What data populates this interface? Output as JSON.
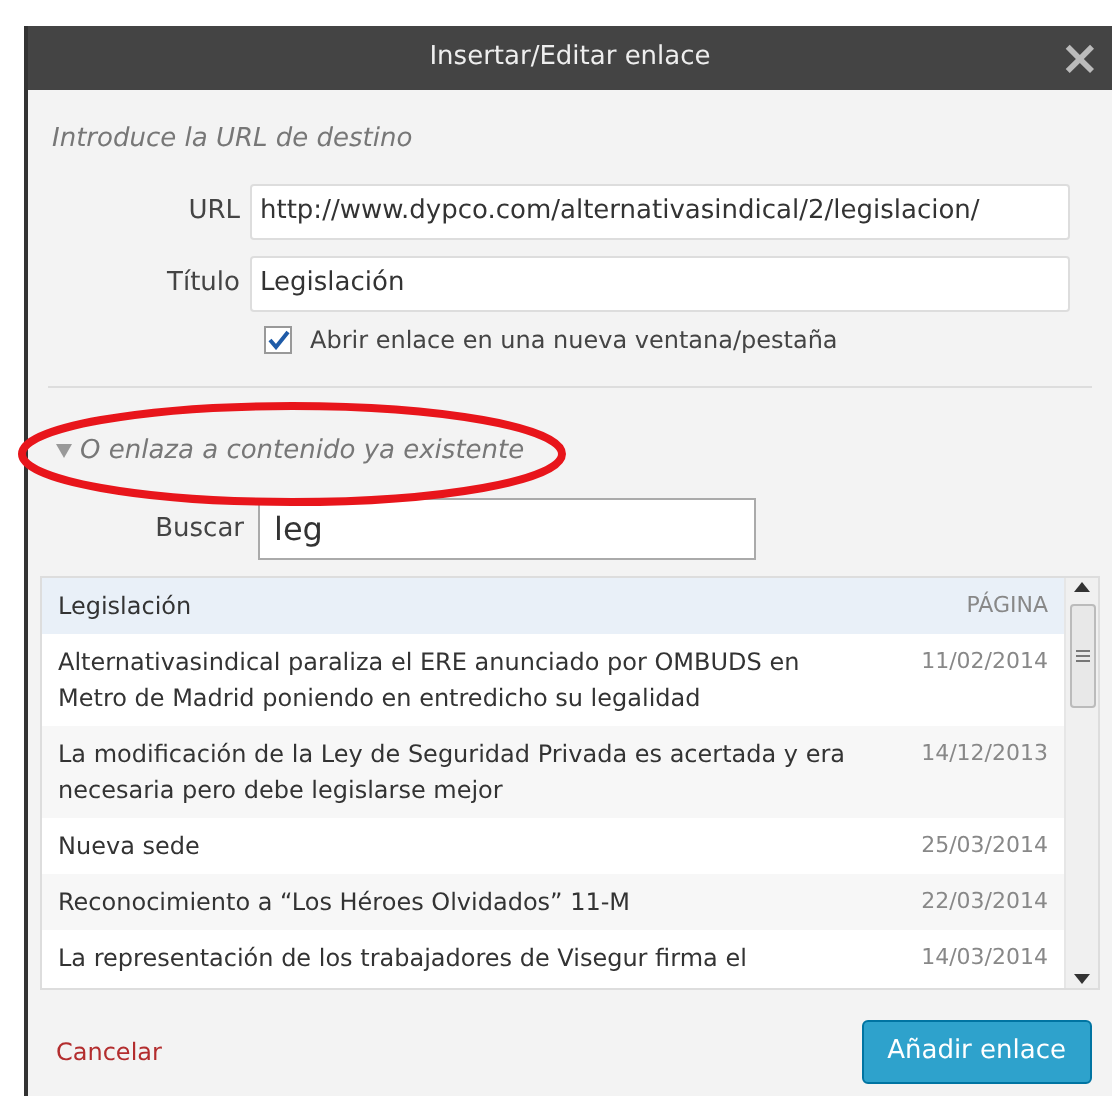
{
  "window": {
    "title": "Insertar/Editar enlace",
    "close": "×"
  },
  "url_section": {
    "heading": "Introduce la URL de destino",
    "url_label": "URL",
    "url_value": "http://www.dypco.com/alternativasindical/2/legislacion/",
    "title_label": "Título",
    "title_value": "Legislación",
    "new_tab": {
      "label": "Abrir enlace en una nueva ventana/pestaña",
      "checked": true
    }
  },
  "existing_section": {
    "toggle": "O enlaza a contenido ya existente",
    "expanded": true,
    "search_label": "Buscar",
    "search_value": "leg"
  },
  "results": [
    {
      "title": "Legislación",
      "info": "PÁGINA",
      "selected": true
    },
    {
      "title": "Alternativasindical paraliza el ERE anunciado por OMBUDS en Metro de Madrid poniendo en entredicho su legalidad",
      "info": "11/02/2014",
      "selected": false
    },
    {
      "title": "La modificación de la Ley de Seguridad Privada es acertada y era necesaria pero debe legislarse mejor",
      "info": "14/12/2013",
      "selected": false
    },
    {
      "title": "Nueva sede",
      "info": "25/03/2014",
      "selected": false
    },
    {
      "title": "Reconocimiento a “Los Héroes Olvidados” 11-M",
      "info": "22/03/2014",
      "selected": false
    },
    {
      "title": "La representación de los trabajadores de Visegur firma el",
      "info": "14/03/2014",
      "selected": false
    }
  ],
  "footer": {
    "cancel": "Cancelar",
    "submit": "Añadir enlace"
  }
}
